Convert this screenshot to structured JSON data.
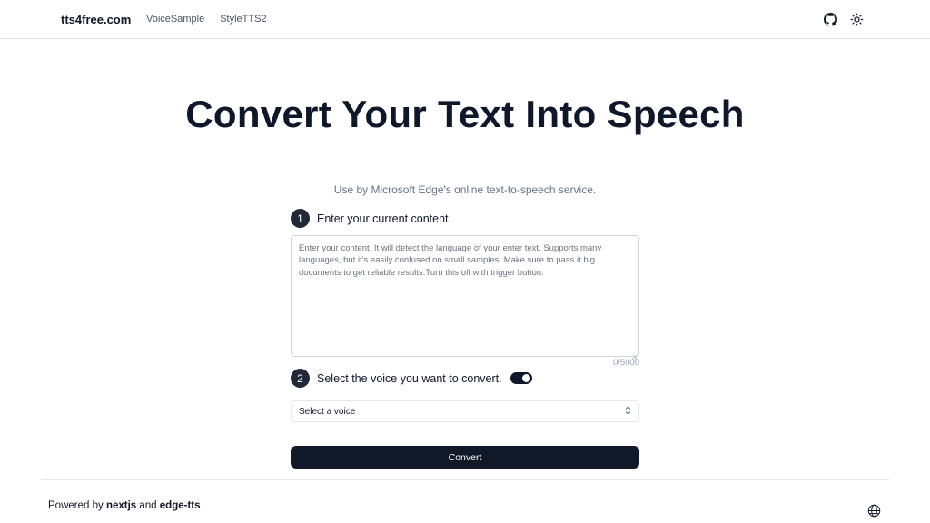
{
  "header": {
    "brand": "tts4free.com",
    "nav": [
      "VoiceSample",
      "StyleTTS2"
    ],
    "icons": {
      "github": "github-icon",
      "theme": "sun-icon"
    }
  },
  "hero": {
    "title": "Convert Your Text Into Speech",
    "subtitle": "Use by Microsoft Edge's online text-to-speech service."
  },
  "step1": {
    "number": "1",
    "label": "Enter your current content.",
    "placeholder": "Enter your content. It will detect the language of your enter text. Supports many languages, but it's easily confused on small samples. Make sure to pass it big documents to get reliable results.Turn this off with trigger button.",
    "value": "",
    "counter": "0/5000"
  },
  "step2": {
    "number": "2",
    "label": "Select the voice you want to convert.",
    "toggle_on": true,
    "select_value": "Select a voice"
  },
  "convert_label": "Convert",
  "footer": {
    "prefix": "Powered by",
    "tech1": "nextjs",
    "joiner": "and",
    "tech2": "edge-tts",
    "icon": "globe-icon"
  },
  "colors": {
    "primary": "#111827",
    "muted_text": "#64748b",
    "border": "#e5e7eb"
  }
}
